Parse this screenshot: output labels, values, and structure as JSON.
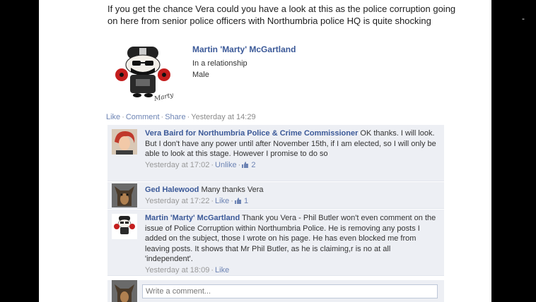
{
  "post": {
    "text": "If you get the chance Vera could you have a look at this as the police corruption going on here from senior police officers with Northumbria police HQ is quite shocking"
  },
  "shared_profile": {
    "name": "Martin 'Marty' McGartland",
    "line1": "In a relationship",
    "line2": "Male",
    "avatar_caption": "Marty"
  },
  "post_actions": {
    "like": "Like",
    "comment": "Comment",
    "share": "Share",
    "timestamp": "Yesterday at 14:29"
  },
  "comments": [
    {
      "author": "Vera Baird for Northumbria Police & Crime Commissioner",
      "text": "OK thanks. I will look. But I don't have any power until after November 15th, if I am elected, so I will only be able to look at this stage. However I promise to do so",
      "time": "Yesterday at 17:02",
      "action": "Unlike",
      "likes": "2"
    },
    {
      "author": "Ged Halewood",
      "text": "Many thanks Vera",
      "time": "Yesterday at 17:22",
      "action": "Like",
      "likes": "1"
    },
    {
      "author": "Martin 'Marty' McGartland",
      "text": "Thank you Vera - Phil Butler won't even comment on the issue of Police Corruption within Northumbria Police. He is removing any posts I added on the subject, those I wrote on his page. He has even blocked me from leaving posts. It shows that Mr Phil Butler, as he is claiming,r is no at all 'independent'.",
      "time": "Yesterday at 18:09",
      "action": "Like"
    }
  ],
  "compose": {
    "placeholder": "Write a comment..."
  },
  "colors": {
    "link": "#3b5998",
    "comment_bg": "#edeff4"
  }
}
